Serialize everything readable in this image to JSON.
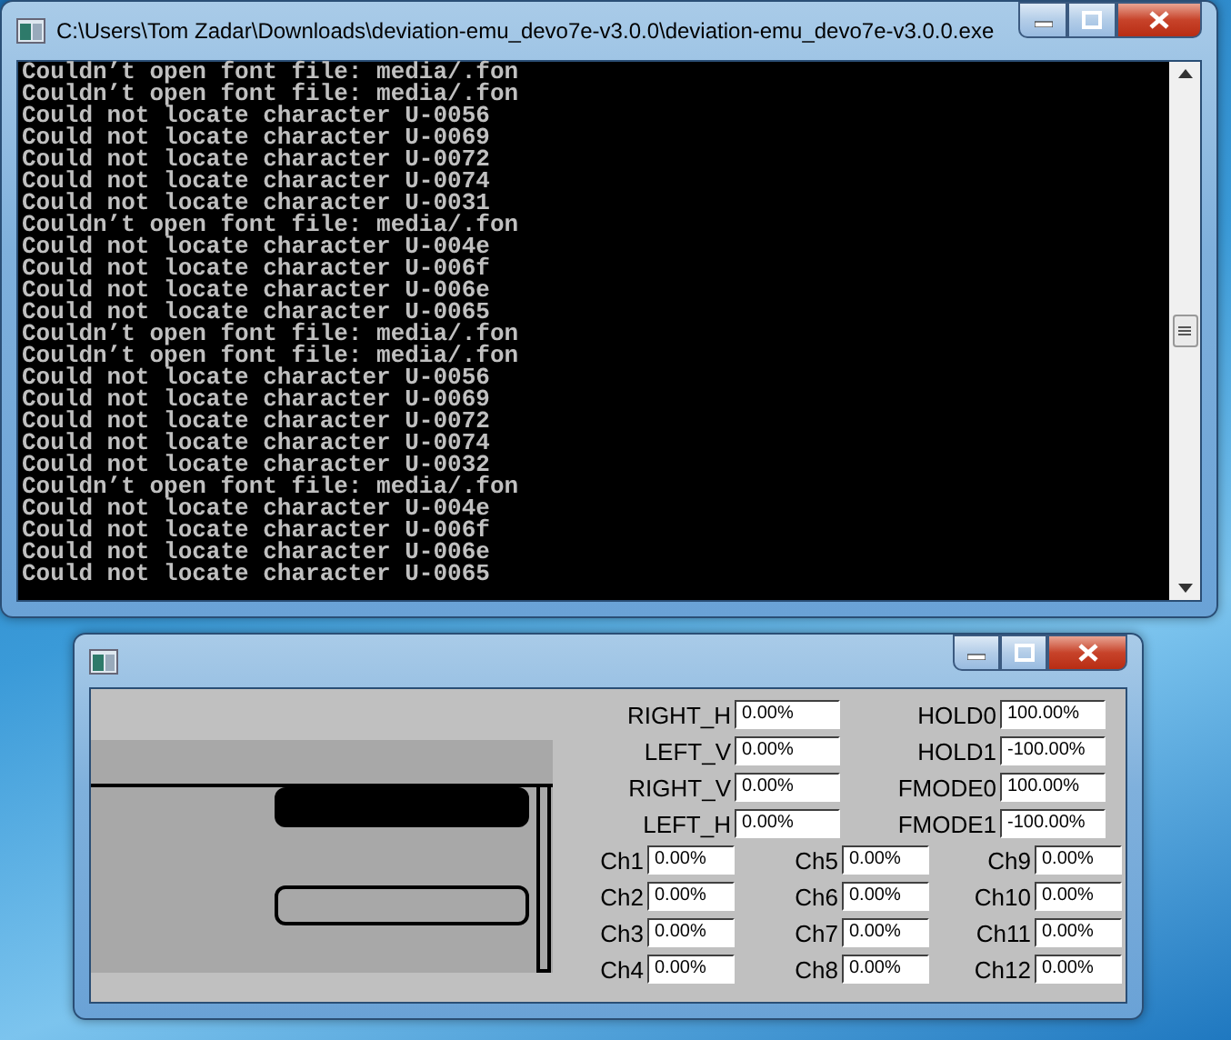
{
  "console": {
    "title": "C:\\Users\\Tom Zadar\\Downloads\\deviation-emu_devo7e-v3.0.0\\deviation-emu_devo7e-v3.0.0.exe",
    "lines": [
      "Couldn’t open font file: media/.fon",
      "Couldn’t open font file: media/.fon",
      "Could not locate character U-0056",
      "Could not locate character U-0069",
      "Could not locate character U-0072",
      "Could not locate character U-0074",
      "Could not locate character U-0031",
      "Couldn’t open font file: media/.fon",
      "Could not locate character U-004e",
      "Could not locate character U-006f",
      "Could not locate character U-006e",
      "Could not locate character U-0065",
      "Couldn’t open font file: media/.fon",
      "Couldn’t open font file: media/.fon",
      "Could not locate character U-0056",
      "Could not locate character U-0069",
      "Could not locate character U-0072",
      "Could not locate character U-0074",
      "Could not locate character U-0032",
      "Couldn’t open font file: media/.fon",
      "Could not locate character U-004e",
      "Could not locate character U-006f",
      "Could not locate character U-006e",
      "Could not locate character U-0065"
    ]
  },
  "emulator": {
    "sticks": [
      {
        "label": "RIGHT_H",
        "value": "0.00%"
      },
      {
        "label": "LEFT_V",
        "value": "0.00%"
      },
      {
        "label": "RIGHT_V",
        "value": "0.00%"
      },
      {
        "label": "LEFT_H",
        "value": "0.00%"
      }
    ],
    "switches": [
      {
        "label": "HOLD0",
        "value": "100.00%"
      },
      {
        "label": "HOLD1",
        "value": "-100.00%"
      },
      {
        "label": "FMODE0",
        "value": "100.00%"
      },
      {
        "label": "FMODE1",
        "value": "-100.00%"
      }
    ],
    "channels": [
      {
        "label": "Ch1",
        "value": "0.00%"
      },
      {
        "label": "Ch5",
        "value": "0.00%"
      },
      {
        "label": "Ch9",
        "value": "0.00%"
      },
      {
        "label": "Ch2",
        "value": "0.00%"
      },
      {
        "label": "Ch6",
        "value": "0.00%"
      },
      {
        "label": "Ch10",
        "value": "0.00%"
      },
      {
        "label": "Ch3",
        "value": "0.00%"
      },
      {
        "label": "Ch7",
        "value": "0.00%"
      },
      {
        "label": "Ch11",
        "value": "0.00%"
      },
      {
        "label": "Ch4",
        "value": "0.00%"
      },
      {
        "label": "Ch8",
        "value": "0.00%"
      },
      {
        "label": "Ch12",
        "value": "0.00%"
      }
    ]
  }
}
